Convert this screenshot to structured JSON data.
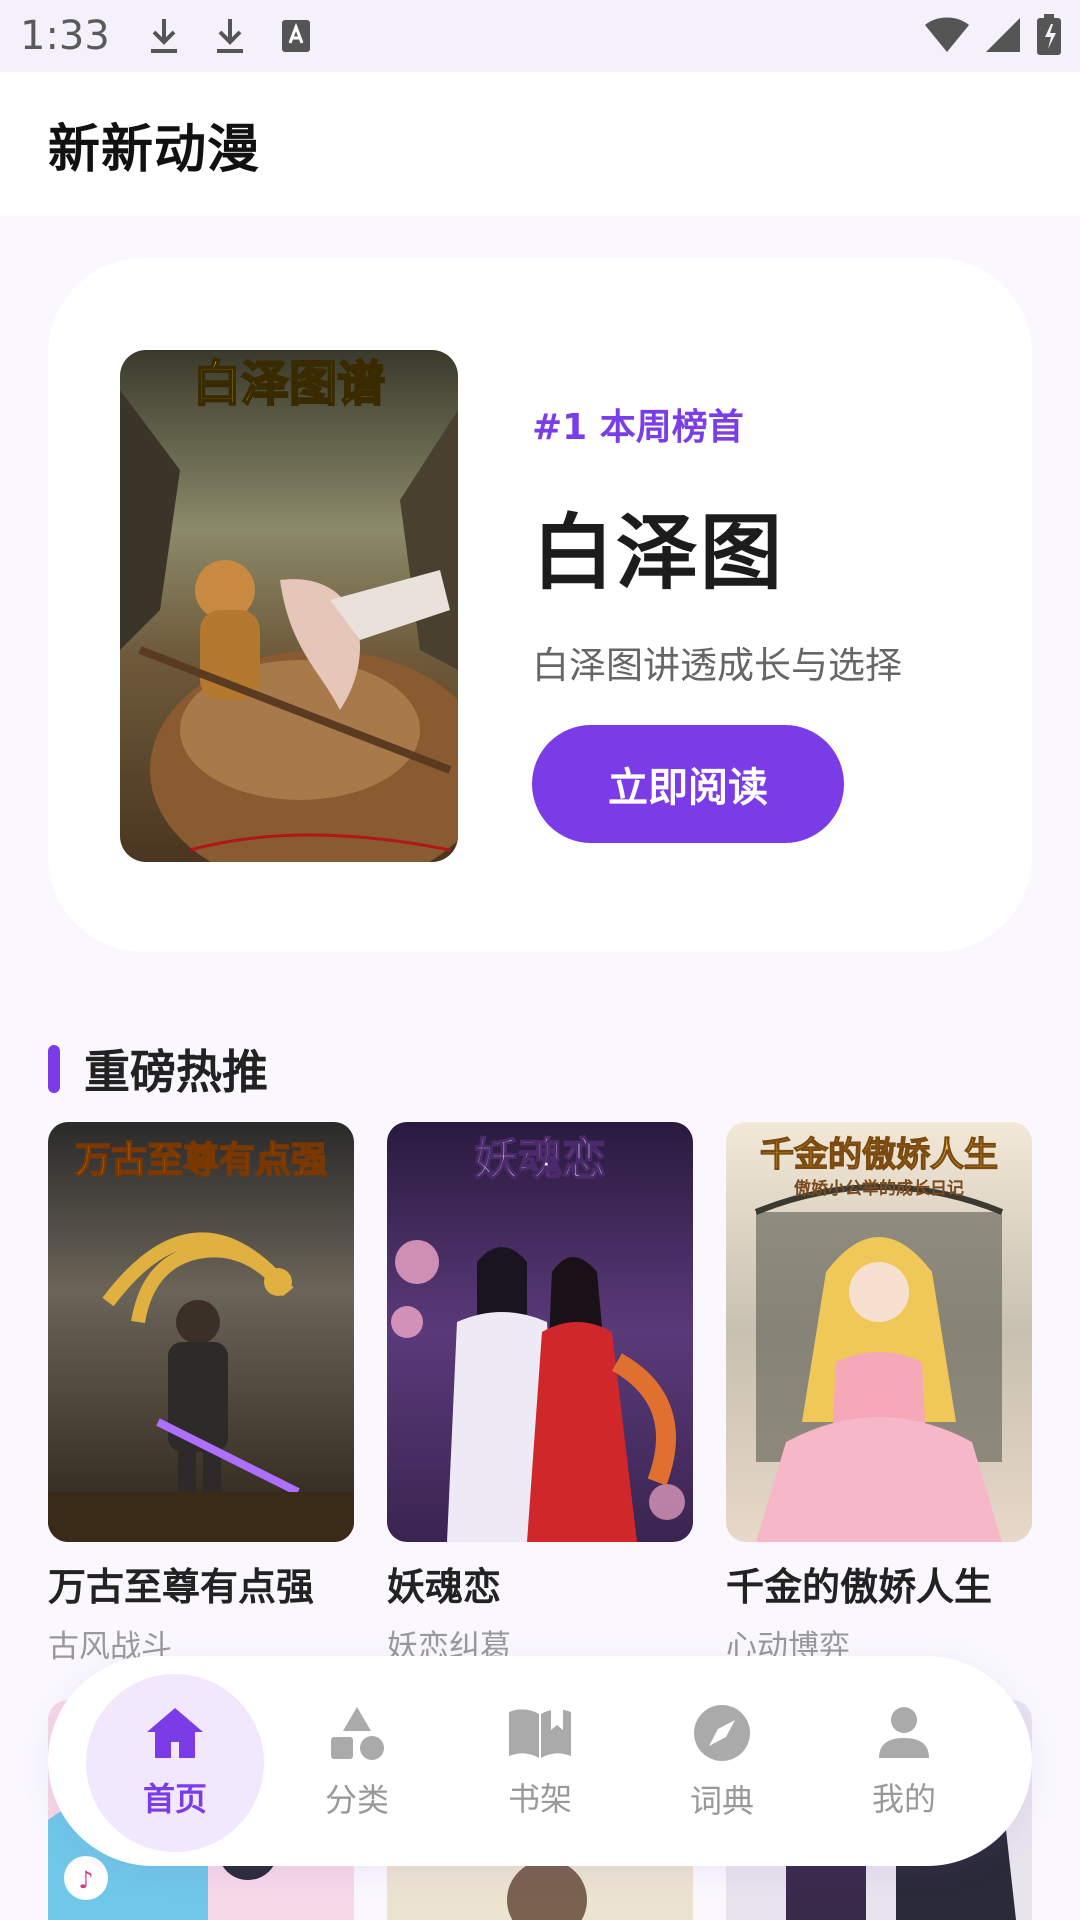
{
  "status_bar": {
    "time": "1:33"
  },
  "header": {
    "title": "新新动漫"
  },
  "hero": {
    "cover_text": "白泽图谱",
    "rank": "#1 本周榜首",
    "title": "白泽图",
    "description": "白泽图讲透成长与选择",
    "read_button": "立即阅读"
  },
  "section": {
    "title": "重磅热推",
    "accent_color": "#7b3be6"
  },
  "books": [
    {
      "title": "万古至尊有点强",
      "tag": "古风战斗",
      "cover_text": "万古至尊有点强"
    },
    {
      "title": "妖魂恋",
      "tag": "妖恋纠葛",
      "cover_text": "妖魂恋"
    },
    {
      "title": "千金的傲娇人生",
      "tag": "心动博弈",
      "cover_text": "千金的傲娇人生",
      "cover_subtext": "傲娇小公举的成长日记"
    }
  ],
  "nav": {
    "items": [
      {
        "label": "首页",
        "icon": "home-icon",
        "active": true
      },
      {
        "label": "分类",
        "icon": "category-icon",
        "active": false
      },
      {
        "label": "书架",
        "icon": "book-icon",
        "active": false
      },
      {
        "label": "词典",
        "icon": "compass-icon",
        "active": false
      },
      {
        "label": "我的",
        "icon": "person-icon",
        "active": false
      }
    ]
  },
  "colors": {
    "accent": "#7b3be6",
    "background": "#faf8fe",
    "active_nav_bg": "#f1e8fd"
  }
}
